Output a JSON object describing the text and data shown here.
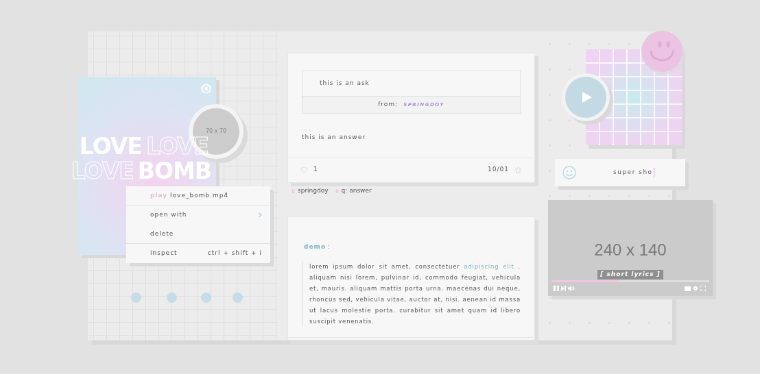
{
  "image_card": {
    "size_label": "70 x 70",
    "title_lines": [
      [
        {
          "text": "LOVE",
          "kind": "filled"
        },
        {
          "text": "LOVE",
          "kind": "outline"
        }
      ],
      [
        {
          "text": "LOVE",
          "kind": "outline"
        },
        {
          "text": "BOMB",
          "kind": "filled"
        }
      ]
    ]
  },
  "context_menu": [
    {
      "kind": "action",
      "verb": "play",
      "label": "love_bomb.mp4",
      "divider_after": true
    },
    {
      "kind": "submenu",
      "label": "open with",
      "divider_after": false
    },
    {
      "kind": "plain",
      "label": "delete",
      "divider_after": true
    },
    {
      "kind": "shortcut",
      "label": "inspect",
      "shortcut": "ctrl + shift + i",
      "divider_after": false
    }
  ],
  "ask_post": {
    "ask": "this is an ask",
    "from_label": "from:",
    "asker": "SPRINGDOY",
    "answer": "this is an answer",
    "likes": "1",
    "date": "10/01",
    "tags": [
      "springdoy",
      "q: answer"
    ]
  },
  "text_post": {
    "heading": "demo",
    "colon": ":",
    "body": "lorem ipsum dolor sit amet, consectetuer **adipiscing elit** . aliquam nisi lorem, pulvinar id, commodo feugiat, vehicula et, mauris. aliquam mattis porta urna. maecenas dui neque, rhoncus sed, vehicula vitae, auctor at, nisi. aenean id massa ut lacus molestie porta. curabitur sit amet quam id libero suscipit venenatis."
  },
  "message_field": {
    "value": "super sho"
  },
  "video": {
    "size_label": "240 x 140",
    "lyrics": "[ short lyrics ]",
    "level": 0.43
  }
}
